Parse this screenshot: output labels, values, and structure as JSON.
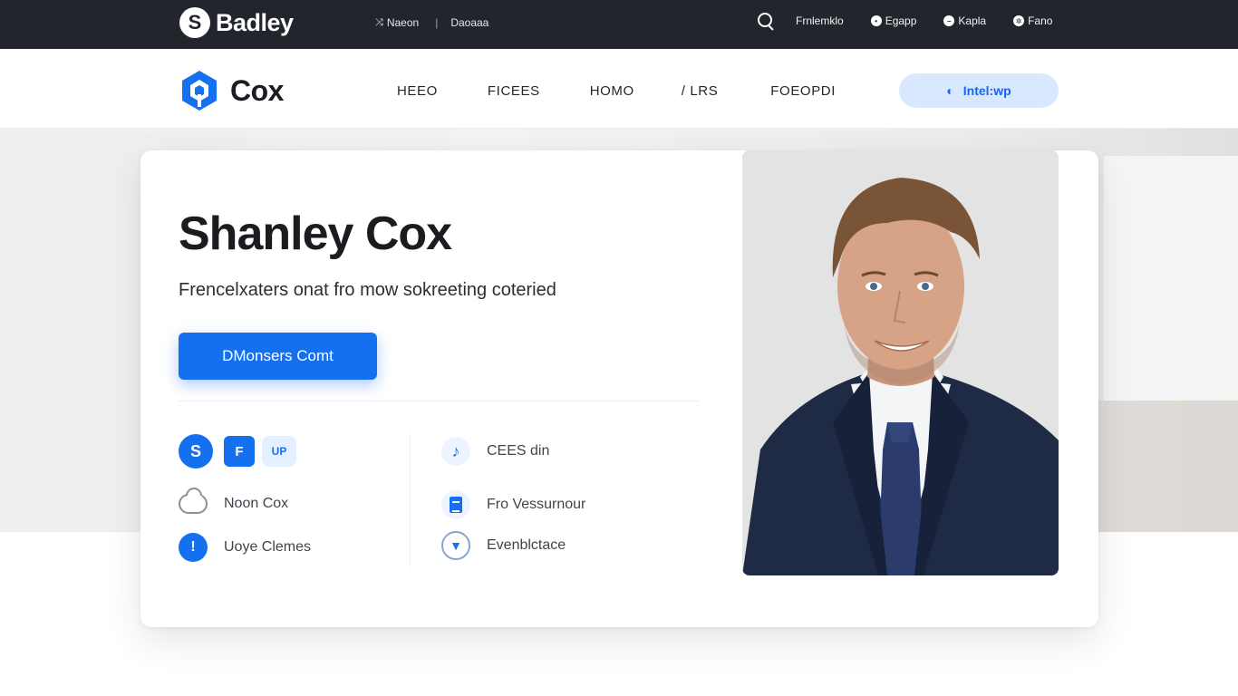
{
  "topbar": {
    "brand_initial": "S",
    "brand_name": "Badley",
    "link_1": "Naeon",
    "link_2": "Daoaaa",
    "right_items": [
      "Frnlemklo",
      "Egapp",
      "Kapla",
      "Fano"
    ]
  },
  "nav": {
    "logo_name": "Cox",
    "menu": [
      "HEEO",
      "FICEES",
      "HOMO",
      "/ LRS",
      "FOEOPDI"
    ],
    "cta_label": "Intel:wp"
  },
  "hero": {
    "name": "Shanley Cox",
    "tagline": "Frencelxaters onat fro mow sokreeting coteried",
    "primary_button": "DMonsers Comt",
    "socials": {
      "s": "S",
      "f": "F",
      "up": "UP"
    },
    "info_left": [
      {
        "icon": "cloud-icon",
        "label": "Noon Cox"
      },
      {
        "icon": "pin-icon",
        "label": "Uoye Clemes"
      }
    ],
    "info_right": [
      {
        "icon": "music-note-icon",
        "label": "CEES din"
      },
      {
        "icon": "document-icon",
        "label": "Fro Vessurnour"
      },
      {
        "icon": "shield-icon",
        "label": "Evenblctace"
      }
    ]
  },
  "colors": {
    "accent": "#1570f0",
    "topbar": "#22252c",
    "cta_bg": "#d9e8ff"
  }
}
